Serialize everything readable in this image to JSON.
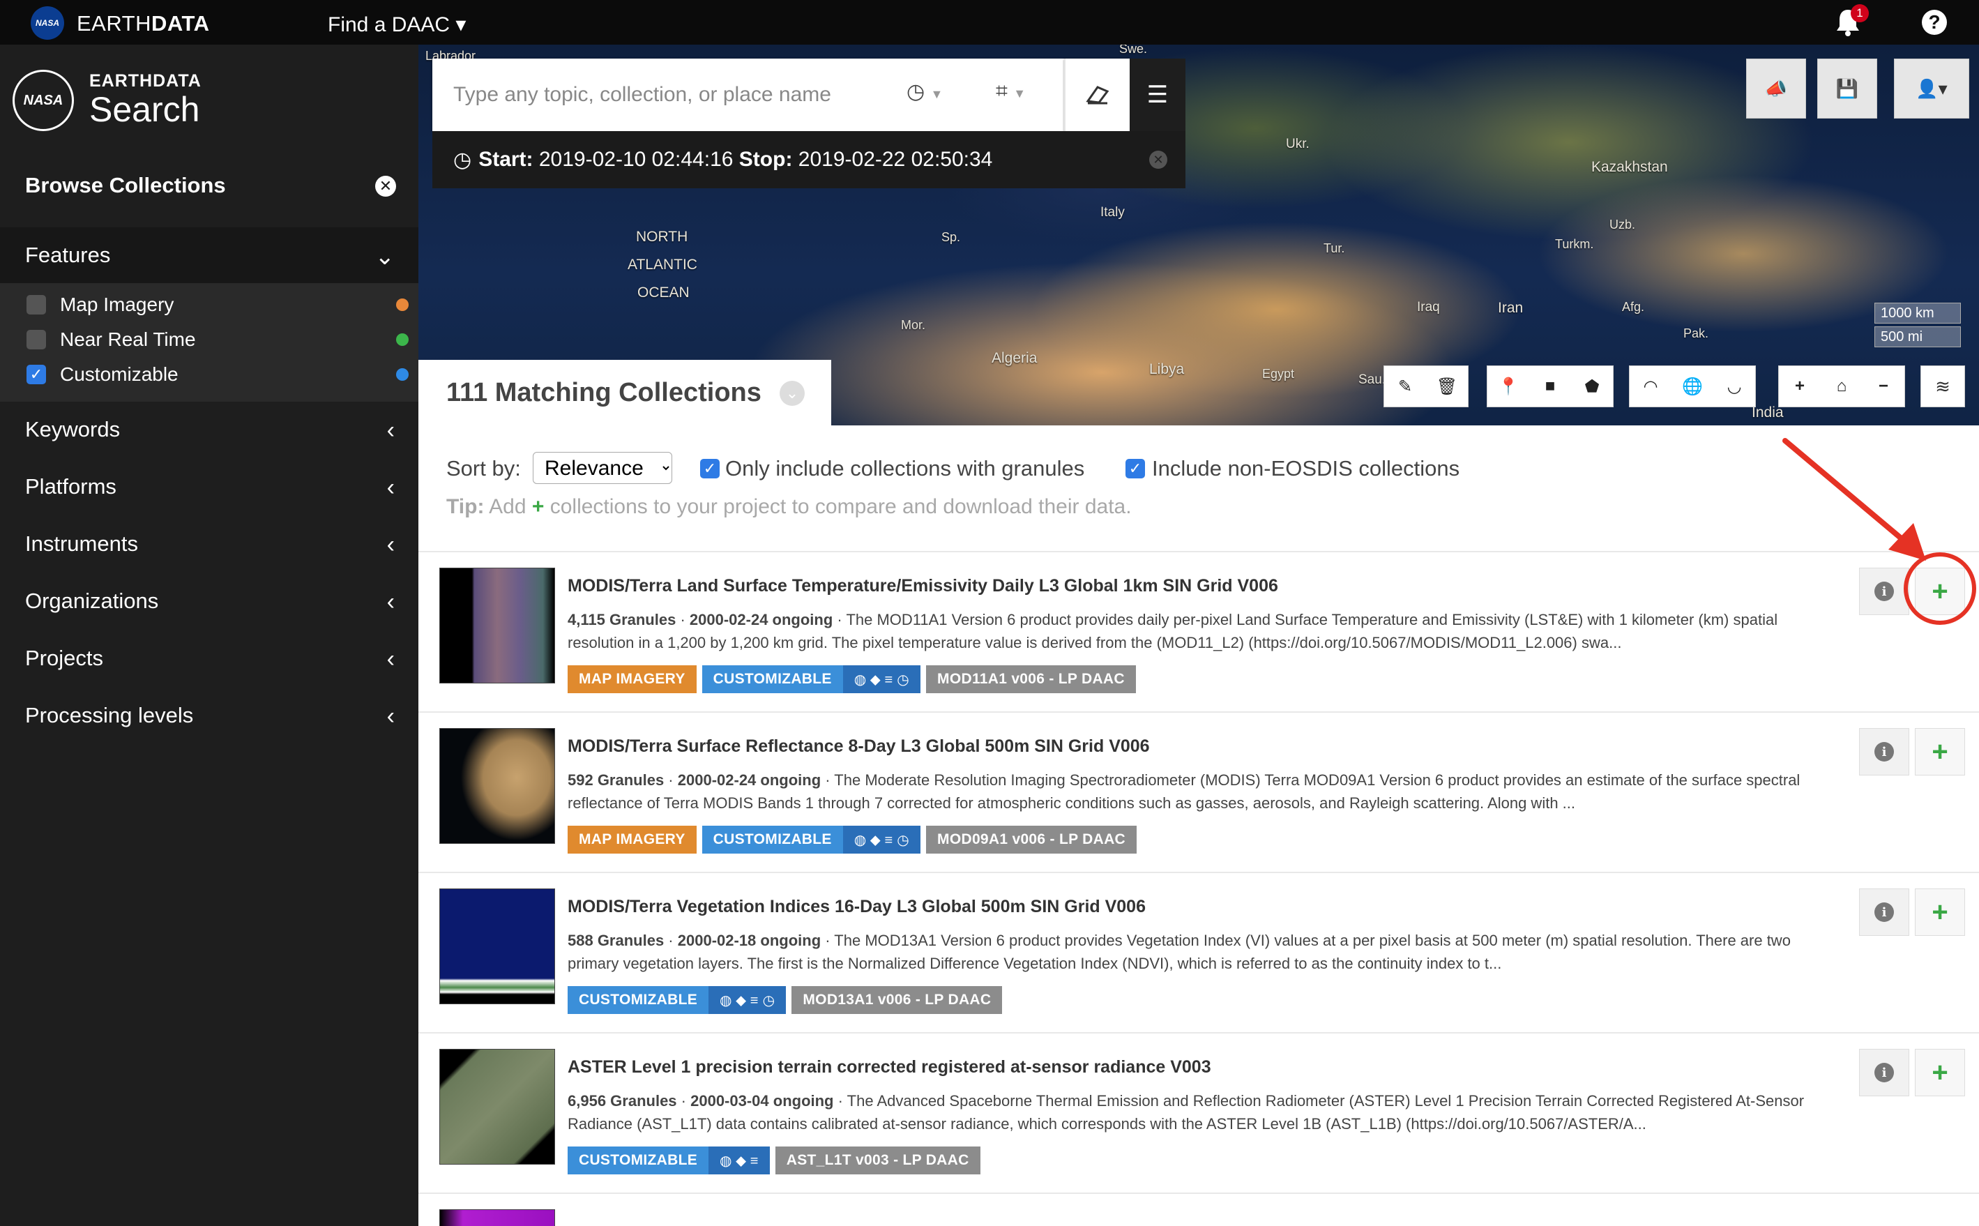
{
  "topbar": {
    "logo": "NASA",
    "brand_light": "EARTH",
    "brand_bold": "DATA",
    "find_daac": "Find a DAAC ▾",
    "notification_count": "1",
    "help": "?"
  },
  "sidebar": {
    "logo": "NASA",
    "earthdata": "EARTHDATA",
    "search": "Search",
    "browse_title": "Browse Collections",
    "features_label": "Features",
    "features": [
      {
        "label": "Map Imagery",
        "checked": false,
        "dot_color": "#e8883a"
      },
      {
        "label": "Near Real Time",
        "checked": false,
        "dot_color": "#3cb64b"
      },
      {
        "label": "Customizable",
        "checked": true,
        "dot_color": "#2e8ae6"
      }
    ],
    "sections": [
      "Keywords",
      "Platforms",
      "Instruments",
      "Organizations",
      "Projects",
      "Processing levels"
    ]
  },
  "map": {
    "search_placeholder": "Type any topic, collection, or place name",
    "time_start_label": "Start:",
    "time_start": "2019-02-10 02:44:16",
    "time_stop_label": "Stop:",
    "time_stop": "2019-02-22 02:50:34",
    "labels": [
      "NORTH",
      "ATLANTIC",
      "OCEAN",
      "Algeria",
      "Libya",
      "Egypt",
      "Mor.",
      "Sp.",
      "Italy",
      "Ukr.",
      "Kazakhstan",
      "Uzb.",
      "Turkm.",
      "Tur.",
      "Iraq",
      "Iran",
      "Afg.",
      "Pak.",
      "India",
      "Sau.",
      "Labrador",
      "Swe."
    ],
    "scale_km": "1000 km",
    "scale_mi": "500 mi"
  },
  "results": {
    "title": "111 Matching Collections",
    "sort_label": "Sort by:",
    "sort_value": "Relevance",
    "opt_granules": "Only include collections with granules",
    "opt_non_eosdis": "Include non-EOSDIS collections",
    "tip_label": "Tip:",
    "tip_before": "Add",
    "tip_after": "collections to your project to compare and download their data.",
    "items": [
      {
        "title": "MODIS/Terra Land Surface Temperature/Emissivity Daily L3 Global 1km SIN Grid V006",
        "granules": "4,115 Granules",
        "dates": "2000-02-24 ongoing",
        "desc": "The MOD11A1 Version 6 product provides daily per-pixel Land Surface Temperature and Emissivity (LST&E) with 1 kilometer (km) spatial resolution in a 1,200 by 1,200 km grid. The pixel temperature value is derived from the (MOD11_L2) (https://doi.org/10.5067/MODIS/MOD11_L2.006) swa...",
        "tag_map": "MAP IMAGERY",
        "tag_custom": "CUSTOMIZABLE",
        "tag_id": "MOD11A1 v006 - LP DAAC"
      },
      {
        "title": "MODIS/Terra Surface Reflectance 8-Day L3 Global 500m SIN Grid V006",
        "granules": "592 Granules",
        "dates": "2000-02-24 ongoing",
        "desc": "The Moderate Resolution Imaging Spectroradiometer (MODIS) Terra MOD09A1 Version 6 product provides an estimate of the surface spectral reflectance of Terra MODIS Bands 1 through 7 corrected for atmospheric conditions such as gasses, aerosols, and Rayleigh scattering. Along with ...",
        "tag_map": "MAP IMAGERY",
        "tag_custom": "CUSTOMIZABLE",
        "tag_id": "MOD09A1 v006 - LP DAAC"
      },
      {
        "title": "MODIS/Terra Vegetation Indices 16-Day L3 Global 500m SIN Grid V006",
        "granules": "588 Granules",
        "dates": "2000-02-18 ongoing",
        "desc": "The MOD13A1 Version 6 product provides Vegetation Index (VI) values at a per pixel basis at 500 meter (m) spatial resolution. There are two primary vegetation layers. The first is the Normalized Difference Vegetation Index (NDVI), which is referred to as the continuity index to t...",
        "tag_custom": "CUSTOMIZABLE",
        "tag_id": "MOD13A1 v006 - LP DAAC"
      },
      {
        "title": "ASTER Level 1 precision terrain corrected registered at-sensor radiance V003",
        "granules": "6,956 Granules",
        "dates": "2000-03-04 ongoing",
        "desc": "The Advanced Spaceborne Thermal Emission and Reflection Radiometer (ASTER) Level 1 Precision Terrain Corrected Registered At-Sensor Radiance (AST_L1T) data contains calibrated at-sensor radiance, which corresponds with the ASTER Level 1B (AST_L1B) (https://doi.org/10.5067/ASTER/A...",
        "tag_custom": "CUSTOMIZABLE",
        "tag_id": "AST_L1T v003 - LP DAAC"
      }
    ]
  },
  "colors": {
    "accent_blue": "#2e7be5",
    "add_green": "#3aa845",
    "annotation_red": "#e53224",
    "tag_orange": "#e08a2e",
    "tag_blue": "#3b8fd9"
  }
}
